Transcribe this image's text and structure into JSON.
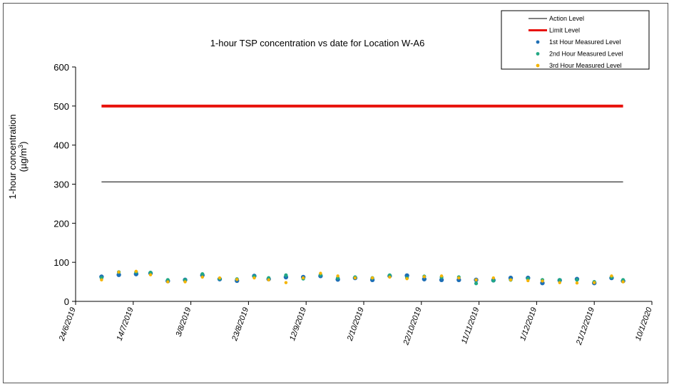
{
  "chart_data": {
    "type": "scatter",
    "title": "1-hour TSP concentration vs date for Location  W-A6",
    "ylabel_line1": "1-hour concentration",
    "ylabel_line2_prefix": "(µg/m",
    "ylabel_line2_sup": "3",
    "ylabel_line2_suffix": ")",
    "xlabel": "",
    "ylim": [
      0,
      600
    ],
    "yticks": [
      "0",
      "100",
      "200",
      "300",
      "400",
      "500",
      "600"
    ],
    "ytick_values": [
      0,
      100,
      200,
      300,
      400,
      500,
      600
    ],
    "xlim": [
      "2019-06-24",
      "2020-01-10"
    ],
    "xticks": [
      "24/6/2019",
      "14/7/2019",
      "3/8/2019",
      "23/8/2019",
      "12/9/2019",
      "2/10/2019",
      "22/10/2019",
      "11/11/2019",
      "1/12/2019",
      "21/12/2019",
      "10/1/2020"
    ],
    "xtick_dates": [
      "2019-06-24",
      "2019-07-14",
      "2019-08-03",
      "2019-08-23",
      "2019-09-12",
      "2019-10-02",
      "2019-10-22",
      "2019-11-11",
      "2019-12-01",
      "2019-12-21",
      "2020-01-10"
    ],
    "grid": false,
    "legend_position": "top-right",
    "series": [
      {
        "name": "Action Level",
        "kind": "line",
        "color": "#000000",
        "x": [
          "2019-07-03",
          "2019-12-31"
        ],
        "values": [
          306,
          306
        ]
      },
      {
        "name": "Limit Level",
        "kind": "line",
        "color": "#e8120c",
        "x": [
          "2019-07-03",
          "2019-12-31"
        ],
        "values": [
          500,
          500
        ]
      },
      {
        "name": "1st Hour Measured Level",
        "kind": "points",
        "color": "#1f6fb5",
        "x": [
          "2019-07-03",
          "2019-07-09",
          "2019-07-15",
          "2019-07-20",
          "2019-07-26",
          "2019-08-01",
          "2019-08-07",
          "2019-08-13",
          "2019-08-19",
          "2019-08-25",
          "2019-08-30",
          "2019-09-05",
          "2019-09-11",
          "2019-09-17",
          "2019-09-23",
          "2019-09-29",
          "2019-10-05",
          "2019-10-11",
          "2019-10-17",
          "2019-10-23",
          "2019-10-29",
          "2019-11-04",
          "2019-11-10",
          "2019-11-16",
          "2019-11-22",
          "2019-11-28",
          "2019-12-03",
          "2019-12-09",
          "2019-12-15",
          "2019-12-21",
          "2019-12-27",
          "2019-12-31"
        ],
        "values": [
          63,
          68,
          70,
          72,
          52,
          55,
          67,
          57,
          53,
          65,
          57,
          62,
          62,
          65,
          56,
          60,
          55,
          65,
          66,
          57,
          55,
          55,
          55,
          54,
          60,
          60,
          47,
          54,
          57,
          47,
          60,
          52
        ]
      },
      {
        "name": "2nd Hour Measured Level",
        "kind": "points",
        "color": "#22a884",
        "x": [
          "2019-07-03",
          "2019-07-09",
          "2019-07-15",
          "2019-07-20",
          "2019-07-26",
          "2019-08-01",
          "2019-08-07",
          "2019-08-13",
          "2019-08-19",
          "2019-08-25",
          "2019-08-30",
          "2019-09-05",
          "2019-09-11",
          "2019-09-17",
          "2019-09-23",
          "2019-09-29",
          "2019-10-05",
          "2019-10-11",
          "2019-10-17",
          "2019-10-23",
          "2019-10-29",
          "2019-11-04",
          "2019-11-10",
          "2019-11-16",
          "2019-11-22",
          "2019-11-28",
          "2019-12-03",
          "2019-12-09",
          "2019-12-15",
          "2019-12-21",
          "2019-12-27",
          "2019-12-31"
        ],
        "values": [
          60,
          75,
          75,
          74,
          55,
          55,
          70,
          58,
          57,
          64,
          60,
          67,
          58,
          68,
          60,
          62,
          60,
          67,
          60,
          64,
          62,
          62,
          46,
          53,
          55,
          58,
          55,
          55,
          55,
          50,
          62,
          55
        ]
      },
      {
        "name": "3rd Hour Measured Level",
        "kind": "points",
        "color": "#f5b400",
        "x": [
          "2019-07-03",
          "2019-07-09",
          "2019-07-15",
          "2019-07-20",
          "2019-07-26",
          "2019-08-01",
          "2019-08-07",
          "2019-08-13",
          "2019-08-19",
          "2019-08-25",
          "2019-08-30",
          "2019-09-05",
          "2019-09-11",
          "2019-09-17",
          "2019-09-23",
          "2019-09-29",
          "2019-10-05",
          "2019-10-11",
          "2019-10-17",
          "2019-10-23",
          "2019-10-29",
          "2019-11-04",
          "2019-11-10",
          "2019-11-16",
          "2019-11-22",
          "2019-11-28",
          "2019-12-03",
          "2019-12-09",
          "2019-12-15",
          "2019-12-21",
          "2019-12-27",
          "2019-12-31"
        ],
        "values": [
          55,
          75,
          77,
          68,
          50,
          50,
          62,
          60,
          56,
          60,
          55,
          48,
          60,
          72,
          65,
          60,
          60,
          62,
          58,
          63,
          65,
          60,
          55,
          60,
          55,
          53,
          52,
          48,
          47,
          48,
          65,
          50
        ]
      }
    ]
  }
}
